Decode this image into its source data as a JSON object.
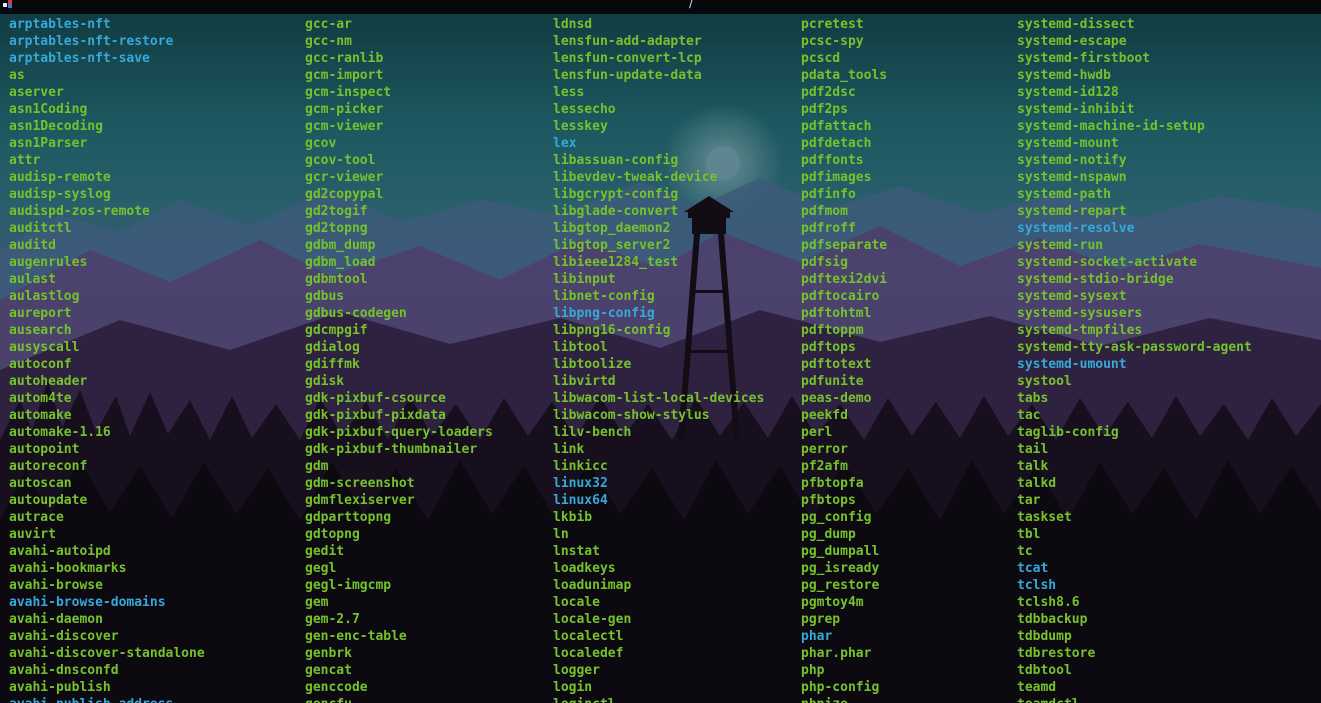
{
  "window": {
    "title": "/"
  },
  "colors": {
    "executable": "#76c22d",
    "symlink": "#36a9d8",
    "topbar": "#06080c"
  },
  "icons": {
    "app": "terminal-app-icon"
  },
  "columns": [
    [
      {
        "name": "arptables-nft",
        "type": "link"
      },
      {
        "name": "arptables-nft-restore",
        "type": "link"
      },
      {
        "name": "arptables-nft-save",
        "type": "link"
      },
      {
        "name": "as",
        "type": "exec"
      },
      {
        "name": "aserver",
        "type": "exec"
      },
      {
        "name": "asn1Coding",
        "type": "exec"
      },
      {
        "name": "asn1Decoding",
        "type": "exec"
      },
      {
        "name": "asn1Parser",
        "type": "exec"
      },
      {
        "name": "attr",
        "type": "exec"
      },
      {
        "name": "audisp-remote",
        "type": "exec"
      },
      {
        "name": "audisp-syslog",
        "type": "exec"
      },
      {
        "name": "audispd-zos-remote",
        "type": "exec"
      },
      {
        "name": "auditctl",
        "type": "exec"
      },
      {
        "name": "auditd",
        "type": "exec"
      },
      {
        "name": "augenrules",
        "type": "exec"
      },
      {
        "name": "aulast",
        "type": "exec"
      },
      {
        "name": "aulastlog",
        "type": "exec"
      },
      {
        "name": "aureport",
        "type": "exec"
      },
      {
        "name": "ausearch",
        "type": "exec"
      },
      {
        "name": "ausyscall",
        "type": "exec"
      },
      {
        "name": "autoconf",
        "type": "exec"
      },
      {
        "name": "autoheader",
        "type": "exec"
      },
      {
        "name": "autom4te",
        "type": "exec"
      },
      {
        "name": "automake",
        "type": "exec"
      },
      {
        "name": "automake-1.16",
        "type": "exec"
      },
      {
        "name": "autopoint",
        "type": "exec"
      },
      {
        "name": "autoreconf",
        "type": "exec"
      },
      {
        "name": "autoscan",
        "type": "exec"
      },
      {
        "name": "autoupdate",
        "type": "exec"
      },
      {
        "name": "autrace",
        "type": "exec"
      },
      {
        "name": "auvirt",
        "type": "exec"
      },
      {
        "name": "avahi-autoipd",
        "type": "exec"
      },
      {
        "name": "avahi-bookmarks",
        "type": "exec"
      },
      {
        "name": "avahi-browse",
        "type": "exec"
      },
      {
        "name": "avahi-browse-domains",
        "type": "link"
      },
      {
        "name": "avahi-daemon",
        "type": "exec"
      },
      {
        "name": "avahi-discover",
        "type": "exec"
      },
      {
        "name": "avahi-discover-standalone",
        "type": "exec"
      },
      {
        "name": "avahi-dnsconfd",
        "type": "exec"
      },
      {
        "name": "avahi-publish",
        "type": "exec"
      },
      {
        "name": "avahi-publish-address",
        "type": "link"
      }
    ],
    [
      {
        "name": "gcc-ar",
        "type": "exec"
      },
      {
        "name": "gcc-nm",
        "type": "exec"
      },
      {
        "name": "gcc-ranlib",
        "type": "exec"
      },
      {
        "name": "gcm-import",
        "type": "exec"
      },
      {
        "name": "gcm-inspect",
        "type": "exec"
      },
      {
        "name": "gcm-picker",
        "type": "exec"
      },
      {
        "name": "gcm-viewer",
        "type": "exec"
      },
      {
        "name": "gcov",
        "type": "exec"
      },
      {
        "name": "gcov-tool",
        "type": "exec"
      },
      {
        "name": "gcr-viewer",
        "type": "exec"
      },
      {
        "name": "gd2copypal",
        "type": "exec"
      },
      {
        "name": "gd2togif",
        "type": "exec"
      },
      {
        "name": "gd2topng",
        "type": "exec"
      },
      {
        "name": "gdbm_dump",
        "type": "exec"
      },
      {
        "name": "gdbm_load",
        "type": "exec"
      },
      {
        "name": "gdbmtool",
        "type": "exec"
      },
      {
        "name": "gdbus",
        "type": "exec"
      },
      {
        "name": "gdbus-codegen",
        "type": "exec"
      },
      {
        "name": "gdcmpgif",
        "type": "exec"
      },
      {
        "name": "gdialog",
        "type": "exec"
      },
      {
        "name": "gdiffmk",
        "type": "exec"
      },
      {
        "name": "gdisk",
        "type": "exec"
      },
      {
        "name": "gdk-pixbuf-csource",
        "type": "exec"
      },
      {
        "name": "gdk-pixbuf-pixdata",
        "type": "exec"
      },
      {
        "name": "gdk-pixbuf-query-loaders",
        "type": "exec"
      },
      {
        "name": "gdk-pixbuf-thumbnailer",
        "type": "exec"
      },
      {
        "name": "gdm",
        "type": "exec"
      },
      {
        "name": "gdm-screenshot",
        "type": "exec"
      },
      {
        "name": "gdmflexiserver",
        "type": "exec"
      },
      {
        "name": "gdparttopng",
        "type": "exec"
      },
      {
        "name": "gdtopng",
        "type": "exec"
      },
      {
        "name": "gedit",
        "type": "exec"
      },
      {
        "name": "gegl",
        "type": "exec"
      },
      {
        "name": "gegl-imgcmp",
        "type": "exec"
      },
      {
        "name": "gem",
        "type": "exec"
      },
      {
        "name": "gem-2.7",
        "type": "exec"
      },
      {
        "name": "gen-enc-table",
        "type": "exec"
      },
      {
        "name": "genbrk",
        "type": "exec"
      },
      {
        "name": "gencat",
        "type": "exec"
      },
      {
        "name": "genccode",
        "type": "exec"
      },
      {
        "name": "gencfu",
        "type": "exec"
      }
    ],
    [
      {
        "name": "ldnsd",
        "type": "exec"
      },
      {
        "name": "lensfun-add-adapter",
        "type": "exec"
      },
      {
        "name": "lensfun-convert-lcp",
        "type": "exec"
      },
      {
        "name": "lensfun-update-data",
        "type": "exec"
      },
      {
        "name": "less",
        "type": "exec"
      },
      {
        "name": "lessecho",
        "type": "exec"
      },
      {
        "name": "lesskey",
        "type": "exec"
      },
      {
        "name": "lex",
        "type": "link"
      },
      {
        "name": "libassuan-config",
        "type": "exec"
      },
      {
        "name": "libevdev-tweak-device",
        "type": "exec"
      },
      {
        "name": "libgcrypt-config",
        "type": "exec"
      },
      {
        "name": "libglade-convert",
        "type": "exec"
      },
      {
        "name": "libgtop_daemon2",
        "type": "exec"
      },
      {
        "name": "libgtop_server2",
        "type": "exec"
      },
      {
        "name": "libieee1284_test",
        "type": "exec"
      },
      {
        "name": "libinput",
        "type": "exec"
      },
      {
        "name": "libnet-config",
        "type": "exec"
      },
      {
        "name": "libpng-config",
        "type": "link"
      },
      {
        "name": "libpng16-config",
        "type": "exec"
      },
      {
        "name": "libtool",
        "type": "exec"
      },
      {
        "name": "libtoolize",
        "type": "exec"
      },
      {
        "name": "libvirtd",
        "type": "exec"
      },
      {
        "name": "libwacom-list-local-devices",
        "type": "exec"
      },
      {
        "name": "libwacom-show-stylus",
        "type": "exec"
      },
      {
        "name": "lilv-bench",
        "type": "exec"
      },
      {
        "name": "link",
        "type": "exec"
      },
      {
        "name": "linkicc",
        "type": "exec"
      },
      {
        "name": "linux32",
        "type": "link"
      },
      {
        "name": "linux64",
        "type": "link"
      },
      {
        "name": "lkbib",
        "type": "exec"
      },
      {
        "name": "ln",
        "type": "exec"
      },
      {
        "name": "lnstat",
        "type": "exec"
      },
      {
        "name": "loadkeys",
        "type": "exec"
      },
      {
        "name": "loadunimap",
        "type": "exec"
      },
      {
        "name": "locale",
        "type": "exec"
      },
      {
        "name": "locale-gen",
        "type": "exec"
      },
      {
        "name": "localectl",
        "type": "exec"
      },
      {
        "name": "localedef",
        "type": "exec"
      },
      {
        "name": "logger",
        "type": "exec"
      },
      {
        "name": "login",
        "type": "exec"
      },
      {
        "name": "loginctl",
        "type": "exec"
      }
    ],
    [
      {
        "name": "pcretest",
        "type": "exec"
      },
      {
        "name": "pcsc-spy",
        "type": "exec"
      },
      {
        "name": "pcscd",
        "type": "exec"
      },
      {
        "name": "pdata_tools",
        "type": "exec"
      },
      {
        "name": "pdf2dsc",
        "type": "exec"
      },
      {
        "name": "pdf2ps",
        "type": "exec"
      },
      {
        "name": "pdfattach",
        "type": "exec"
      },
      {
        "name": "pdfdetach",
        "type": "exec"
      },
      {
        "name": "pdffonts",
        "type": "exec"
      },
      {
        "name": "pdfimages",
        "type": "exec"
      },
      {
        "name": "pdfinfo",
        "type": "exec"
      },
      {
        "name": "pdfmom",
        "type": "exec"
      },
      {
        "name": "pdfroff",
        "type": "exec"
      },
      {
        "name": "pdfseparate",
        "type": "exec"
      },
      {
        "name": "pdfsig",
        "type": "exec"
      },
      {
        "name": "pdftexi2dvi",
        "type": "exec"
      },
      {
        "name": "pdftocairo",
        "type": "exec"
      },
      {
        "name": "pdftohtml",
        "type": "exec"
      },
      {
        "name": "pdftoppm",
        "type": "exec"
      },
      {
        "name": "pdftops",
        "type": "exec"
      },
      {
        "name": "pdftotext",
        "type": "exec"
      },
      {
        "name": "pdfunite",
        "type": "exec"
      },
      {
        "name": "peas-demo",
        "type": "exec"
      },
      {
        "name": "peekfd",
        "type": "exec"
      },
      {
        "name": "perl",
        "type": "exec"
      },
      {
        "name": "perror",
        "type": "exec"
      },
      {
        "name": "pf2afm",
        "type": "exec"
      },
      {
        "name": "pfbtopfa",
        "type": "exec"
      },
      {
        "name": "pfbtops",
        "type": "exec"
      },
      {
        "name": "pg_config",
        "type": "exec"
      },
      {
        "name": "pg_dump",
        "type": "exec"
      },
      {
        "name": "pg_dumpall",
        "type": "exec"
      },
      {
        "name": "pg_isready",
        "type": "exec"
      },
      {
        "name": "pg_restore",
        "type": "exec"
      },
      {
        "name": "pgmtoy4m",
        "type": "exec"
      },
      {
        "name": "pgrep",
        "type": "exec"
      },
      {
        "name": "phar",
        "type": "link"
      },
      {
        "name": "phar.phar",
        "type": "exec"
      },
      {
        "name": "php",
        "type": "exec"
      },
      {
        "name": "php-config",
        "type": "exec"
      },
      {
        "name": "phpize",
        "type": "exec"
      }
    ],
    [
      {
        "name": "systemd-dissect",
        "type": "exec"
      },
      {
        "name": "systemd-escape",
        "type": "exec"
      },
      {
        "name": "systemd-firstboot",
        "type": "exec"
      },
      {
        "name": "systemd-hwdb",
        "type": "exec"
      },
      {
        "name": "systemd-id128",
        "type": "exec"
      },
      {
        "name": "systemd-inhibit",
        "type": "exec"
      },
      {
        "name": "systemd-machine-id-setup",
        "type": "exec"
      },
      {
        "name": "systemd-mount",
        "type": "exec"
      },
      {
        "name": "systemd-notify",
        "type": "exec"
      },
      {
        "name": "systemd-nspawn",
        "type": "exec"
      },
      {
        "name": "systemd-path",
        "type": "exec"
      },
      {
        "name": "systemd-repart",
        "type": "exec"
      },
      {
        "name": "systemd-resolve",
        "type": "link"
      },
      {
        "name": "systemd-run",
        "type": "exec"
      },
      {
        "name": "systemd-socket-activate",
        "type": "exec"
      },
      {
        "name": "systemd-stdio-bridge",
        "type": "exec"
      },
      {
        "name": "systemd-sysext",
        "type": "exec"
      },
      {
        "name": "systemd-sysusers",
        "type": "exec"
      },
      {
        "name": "systemd-tmpfiles",
        "type": "exec"
      },
      {
        "name": "systemd-tty-ask-password-agent",
        "type": "exec"
      },
      {
        "name": "systemd-umount",
        "type": "link"
      },
      {
        "name": "systool",
        "type": "exec"
      },
      {
        "name": "tabs",
        "type": "exec"
      },
      {
        "name": "tac",
        "type": "exec"
      },
      {
        "name": "taglib-config",
        "type": "exec"
      },
      {
        "name": "tail",
        "type": "exec"
      },
      {
        "name": "talk",
        "type": "exec"
      },
      {
        "name": "talkd",
        "type": "exec"
      },
      {
        "name": "tar",
        "type": "exec"
      },
      {
        "name": "taskset",
        "type": "exec"
      },
      {
        "name": "tbl",
        "type": "exec"
      },
      {
        "name": "tc",
        "type": "exec"
      },
      {
        "name": "tcat",
        "type": "link"
      },
      {
        "name": "tclsh",
        "type": "link"
      },
      {
        "name": "tclsh8.6",
        "type": "exec"
      },
      {
        "name": "tdbbackup",
        "type": "exec"
      },
      {
        "name": "tdbdump",
        "type": "exec"
      },
      {
        "name": "tdbrestore",
        "type": "exec"
      },
      {
        "name": "tdbtool",
        "type": "exec"
      },
      {
        "name": "teamd",
        "type": "exec"
      },
      {
        "name": "teamdctl",
        "type": "exec"
      }
    ]
  ]
}
